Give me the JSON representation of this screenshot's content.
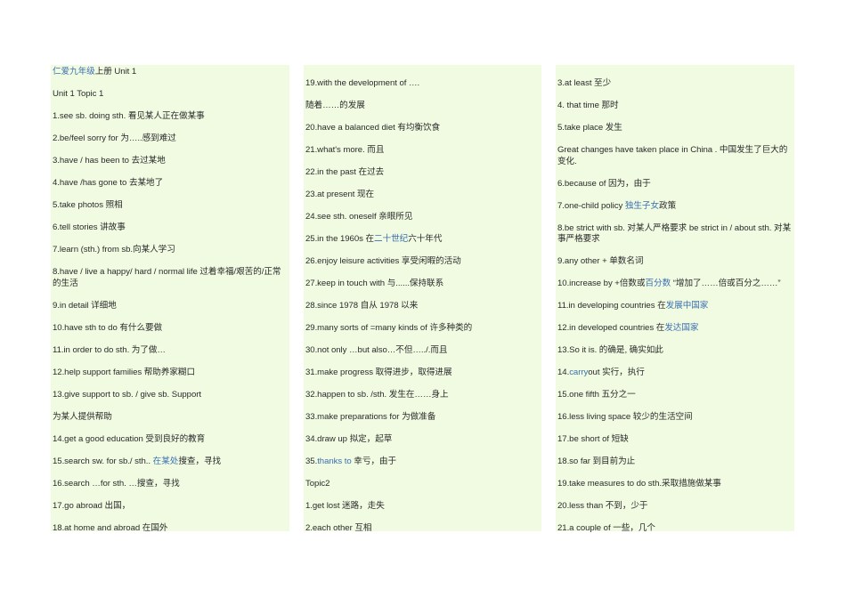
{
  "accent_blue": "#3c6fb0",
  "columns": [
    [
      [
        {
          "t": "仁爱九年级",
          "b": true
        },
        {
          "t": "上册 Unit 1"
        }
      ],
      [
        {
          "t": "Unit 1 Topic 1"
        }
      ],
      [
        {
          "t": "1.see sb. doing sth. 看见某人正在做某事"
        }
      ],
      [
        {
          "t": "2.be/feel sorry for 为…..感到难过"
        }
      ],
      [
        {
          "t": "3.have / has been to 去过某地"
        }
      ],
      [
        {
          "t": "4.have /has gone to 去某地了"
        }
      ],
      [
        {
          "t": "5.take photos 照相"
        }
      ],
      [
        {
          "t": "6.tell stories 讲故事"
        }
      ],
      [
        {
          "t": "7.learn (sth.) from sb.向某人学习"
        }
      ],
      [
        {
          "t": "8.have / live a happy/ hard / normal life 过着幸福/艰苦的/正常的生活"
        }
      ],
      [
        {
          "t": "9.in detail 详细地"
        }
      ],
      [
        {
          "t": "10.have sth to do 有什么要做"
        }
      ],
      [
        {
          "t": "11.in order to do sth. 为了做…"
        }
      ],
      [
        {
          "t": "12.help support families 帮助养家糊口"
        }
      ],
      [
        {
          "t": "13.give support to sb. / give sb. Support"
        }
      ],
      [
        {
          "t": "为某人提供帮助"
        }
      ],
      [
        {
          "t": "14.get a good education 受到良好的教育"
        }
      ],
      [
        {
          "t": "15.search sw. for sb./ sth.. "
        },
        {
          "t": "在某处",
          "b": true
        },
        {
          "t": "搜查，寻找"
        }
      ],
      [
        {
          "t": "16.search …for sth. …搜查，寻找"
        }
      ],
      [
        {
          "t": "17.go abroad 出国，"
        }
      ],
      [
        {
          "t": "18.at home and abroad 在国外"
        }
      ]
    ],
    [
      [
        {
          "t": "19.with the development of …."
        }
      ],
      [
        {
          "t": "随着……的发展"
        }
      ],
      [
        {
          "t": "20.have a balanced diet 有均衡饮食"
        }
      ],
      [
        {
          "t": "21.what's more. 而且"
        }
      ],
      [
        {
          "t": "22.in the past 在过去"
        }
      ],
      [
        {
          "t": "23.at present 现在"
        }
      ],
      [
        {
          "t": "24.see sth. oneself 亲眼所见"
        }
      ],
      [
        {
          "t": "25.in the 1960s 在"
        },
        {
          "t": "二十世纪",
          "b": true
        },
        {
          "t": "六十年代"
        }
      ],
      [
        {
          "t": "26.enjoy leisure activities 享受闲暇的活动"
        }
      ],
      [
        {
          "t": "27.keep in touch with 与......保持联系"
        }
      ],
      [
        {
          "t": "28.since 1978 自从 1978 以来"
        }
      ],
      [
        {
          "t": "29.many sorts of =many kinds of 许多种类的"
        }
      ],
      [
        {
          "t": "30.not only …but also…不但…../.而且"
        }
      ],
      [
        {
          "t": "31.make progress 取得进步，取得进展"
        }
      ],
      [
        {
          "t": "32.happen to sb. /sth. 发生在……身上"
        }
      ],
      [
        {
          "t": "33.make preparations for 为做准备"
        }
      ],
      [
        {
          "t": "34.draw up 拟定，起草"
        }
      ],
      [
        {
          "t": "35."
        },
        {
          "t": "thanks to",
          "b": true
        },
        {
          "t": " 幸亏，由于"
        }
      ],
      [
        {
          "t": "Topic2"
        }
      ],
      [
        {
          "t": "1.get lost 迷路，走失"
        }
      ],
      [
        {
          "t": "2.each other 互相"
        }
      ]
    ],
    [
      [
        {
          "t": "3.at least 至少"
        }
      ],
      [
        {
          "t": "4. that time 那时"
        }
      ],
      [
        {
          "t": "5.take place 发生"
        }
      ],
      [
        {
          "t": "Great changes have taken place in China . 中国发生了巨大的变化."
        }
      ],
      [
        {
          "t": "6.because of 因为，由于"
        }
      ],
      [
        {
          "t": "7.one-child policy "
        },
        {
          "t": "独生子女",
          "b": true
        },
        {
          "t": "政策"
        }
      ],
      [
        {
          "t": "8.be strict with sb. 对某人严格要求 be strict in / about sth. 对某事严格要求"
        }
      ],
      [
        {
          "t": "9.any other + 单数名词"
        }
      ],
      [
        {
          "t": "10.increase by +倍数或"
        },
        {
          "t": "百分数",
          "b": true
        },
        {
          "t": " “增加了……倍或百分之……”"
        }
      ],
      [
        {
          "t": "11.in developing countries 在"
        },
        {
          "t": "发展中国家",
          "b": true
        }
      ],
      [
        {
          "t": "12.in developed countries 在"
        },
        {
          "t": "发达国家",
          "b": true
        }
      ],
      [
        {
          "t": "13.So it is. 的确是, 确实如此"
        }
      ],
      [
        {
          "t": "14."
        },
        {
          "t": "carry",
          "b": true
        },
        {
          "t": "out 实行，执行"
        }
      ],
      [
        {
          "t": "15.one fifth 五分之一"
        }
      ],
      [
        {
          "t": "16.less living space 较少的生活空间"
        }
      ],
      [
        {
          "t": "17.be short of 短缺"
        }
      ],
      [
        {
          "t": "18.so far 到目前为止"
        }
      ],
      [
        {
          "t": "19.take measures to do sth.采取措施做某事"
        }
      ],
      [
        {
          "t": "20.less than 不到，少于"
        }
      ],
      [
        {
          "t": "21.a couple of 一些，几个"
        }
      ]
    ]
  ]
}
